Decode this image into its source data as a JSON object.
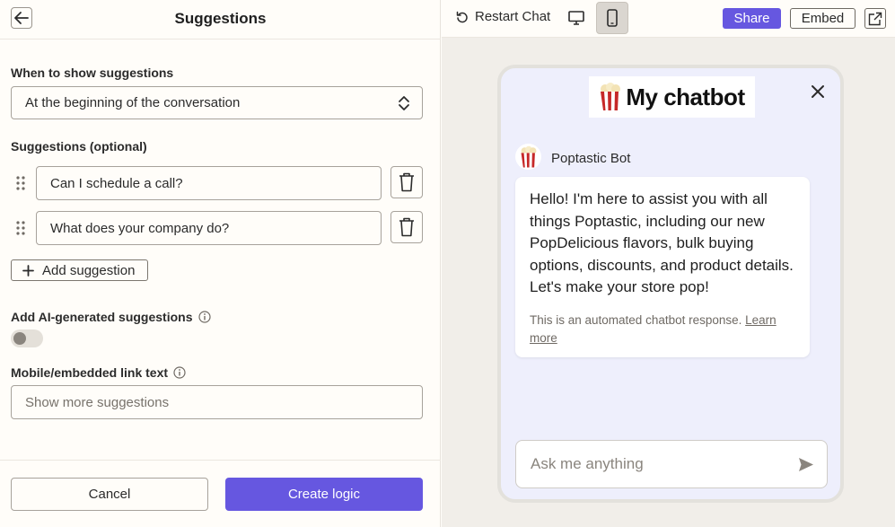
{
  "header": {
    "title": "Suggestions"
  },
  "when": {
    "label": "When to show suggestions",
    "value": "At the beginning of the conversation"
  },
  "suggestions": {
    "label": "Suggestions (optional)",
    "items": [
      {
        "value": "Can I schedule a call?"
      },
      {
        "value": "What does your company do?"
      }
    ],
    "add_label": "Add suggestion"
  },
  "ai": {
    "label": "Add AI-generated suggestions",
    "enabled": false
  },
  "mobile_link": {
    "label": "Mobile/embedded link text",
    "placeholder": "Show more suggestions"
  },
  "footer": {
    "cancel_label": "Cancel",
    "create_label": "Create logic"
  },
  "preview_toolbar": {
    "restart_label": "Restart Chat",
    "share_label": "Share",
    "embed_label": "Embed",
    "active_device": "mobile"
  },
  "chatbot": {
    "logo_text": "My chatbot",
    "bot_name": "Poptastic Bot",
    "message": "Hello! I'm here to assist you with all things Poptastic, including our new PopDelicious flavors, bulk buying options, discounts, and product details. Let's make your store pop!",
    "note": "This is an automated chatbot response.",
    "note_link": "Learn more",
    "input_placeholder": "Ask me anything"
  },
  "colors": {
    "accent": "#6657e0",
    "preview_bg": "#eeeffc",
    "panel_bg": "#fffdf9"
  }
}
